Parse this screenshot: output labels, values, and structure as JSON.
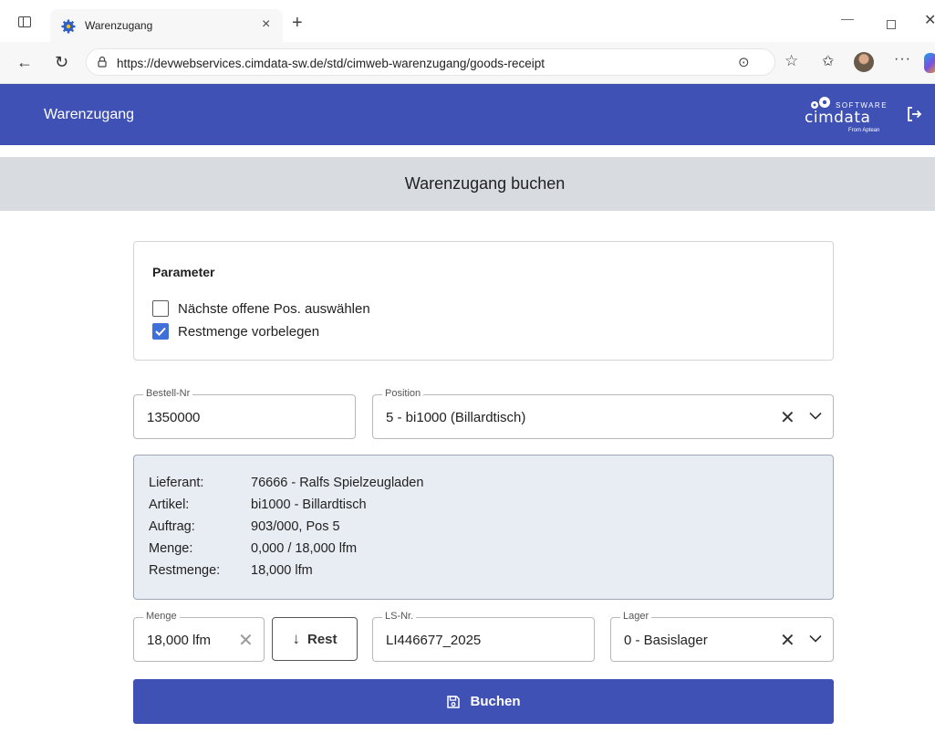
{
  "browser": {
    "tab_title": "Warenzugang",
    "tab_close": "×",
    "new_tab": "+",
    "url": "https://devwebservices.cimdata-sw.de/std/cimweb-warenzugang/goods-receipt",
    "window_minimize": "—",
    "window_close": "✕",
    "more": "···"
  },
  "header": {
    "title": "Warenzugang",
    "logo_software": "SOFTWARE",
    "logo_name": "cimdata",
    "logo_tagline": "From Aptean"
  },
  "page": {
    "title": "Warenzugang buchen"
  },
  "parameter": {
    "heading": "Parameter",
    "options": [
      {
        "label": "Nächste offene Pos. auswählen",
        "checked": false
      },
      {
        "label": "Restmenge vorbelegen",
        "checked": true
      }
    ]
  },
  "form": {
    "bestell_nr": {
      "label": "Bestell-Nr",
      "value": "1350000"
    },
    "position": {
      "label": "Position",
      "value": "5 - bi1000 (Billardtisch)"
    },
    "menge": {
      "label": "Menge",
      "value": "18,000 lfm"
    },
    "ls_nr": {
      "label": "LS-Nr.",
      "value": "LI446677_2025"
    },
    "lager": {
      "label": "Lager",
      "value": "0 - Basislager"
    }
  },
  "info": {
    "rows": [
      {
        "key": "Lieferant:",
        "value": "76666 - Ralfs Spielzeugladen"
      },
      {
        "key": "Artikel:",
        "value": "bi1000 - Billardtisch"
      },
      {
        "key": "Auftrag:",
        "value": "903/000, Pos 5"
      },
      {
        "key": "Menge:",
        "value": "0,000 / 18,000 lfm"
      },
      {
        "key": "Restmenge:",
        "value": "18,000 lfm"
      }
    ]
  },
  "actions": {
    "rest_label": "Rest",
    "buchen_label": "Buchen"
  },
  "colors": {
    "primary": "#3f51b5",
    "checkbox": "#3f6fd8",
    "title_bar": "#d8dbe0",
    "info_box": "#e8ecf3"
  }
}
